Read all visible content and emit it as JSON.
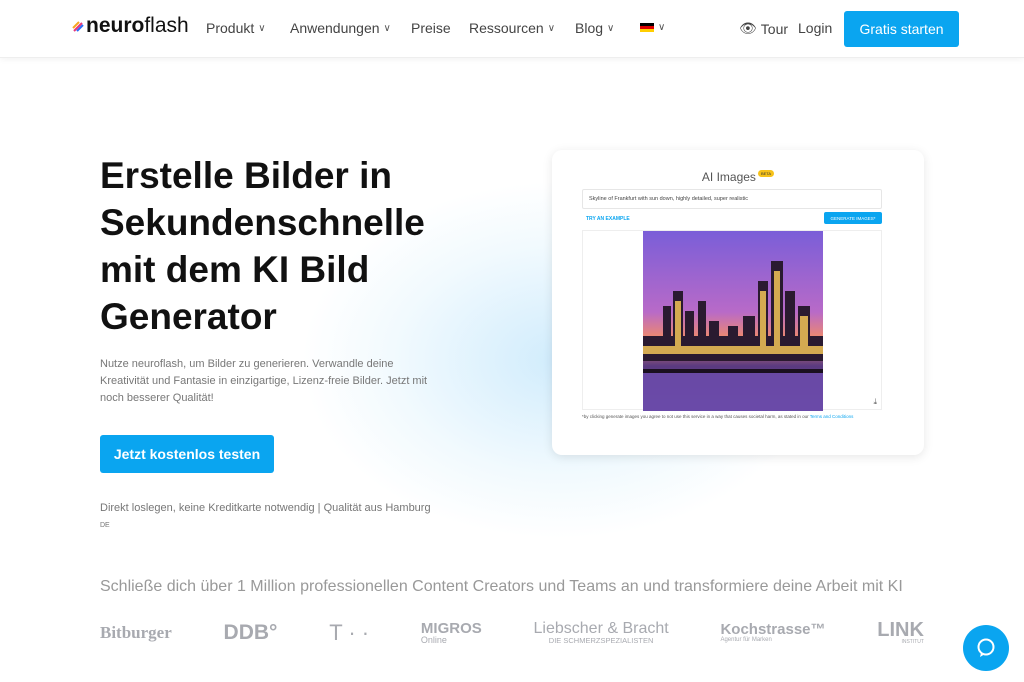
{
  "header": {
    "logo": {
      "bold": "neuro",
      "light": "flash"
    },
    "nav": [
      {
        "label": "Produkt",
        "dropdown": true
      },
      {
        "label": "Anwendungen",
        "dropdown": true
      },
      {
        "label": "Preise",
        "dropdown": false
      },
      {
        "label": "Ressourcen",
        "dropdown": true
      },
      {
        "label": "Blog",
        "dropdown": true
      }
    ],
    "language_flag": "de-flag-icon",
    "tour": "Tour",
    "login": "Login",
    "cta": "Gratis starten"
  },
  "hero": {
    "title": "Erstelle Bilder in Sekundenschnelle mit dem KI Bild Generator",
    "subtitle": "Nutze neuroflash, um Bilder zu generieren. Verwandle deine Kreativität und Fantasie in einzigartige, Lizenz-freie Bilder. Jetzt mit noch besserer Qualität!",
    "button": "Jetzt kostenlos testen",
    "note": "Direkt loslegen, keine Kreditkarte notwendig | Qualität aus Hamburg",
    "lang": "DE"
  },
  "demo": {
    "title": "AI Images",
    "badge": "BETA",
    "prompt": "Skyline of Frankfurt with sun down, highly detailed, super realistic",
    "try_example": "TRY AN EXAMPLE",
    "generate": "GENERATE IMAGES*",
    "terms_text": "*by clicking generate images you agree to not use this service in a way that causes societal harm, as stated in our ",
    "terms_link": "Terms and Conditions"
  },
  "social_proof": {
    "text": "Schließe dich über 1 Million professionellen Content Creators und Teams an und transformiere deine Arbeit mit KI",
    "logos": [
      {
        "name": "Bitburger"
      },
      {
        "name": "DDB°"
      },
      {
        "name": "T · ·"
      },
      {
        "name": "MIGROS",
        "sub": "Online"
      },
      {
        "name": "Liebscher & Bracht",
        "sub": "DIE SCHMERZSPEZIALISTEN"
      },
      {
        "name": "Kochstrasse™",
        "sub": "Agentur für Marken"
      },
      {
        "name": "LINK",
        "sub": "INSTITUT"
      }
    ]
  },
  "colors": {
    "accent": "#0aa5f0",
    "badge": "#f6c21a"
  }
}
